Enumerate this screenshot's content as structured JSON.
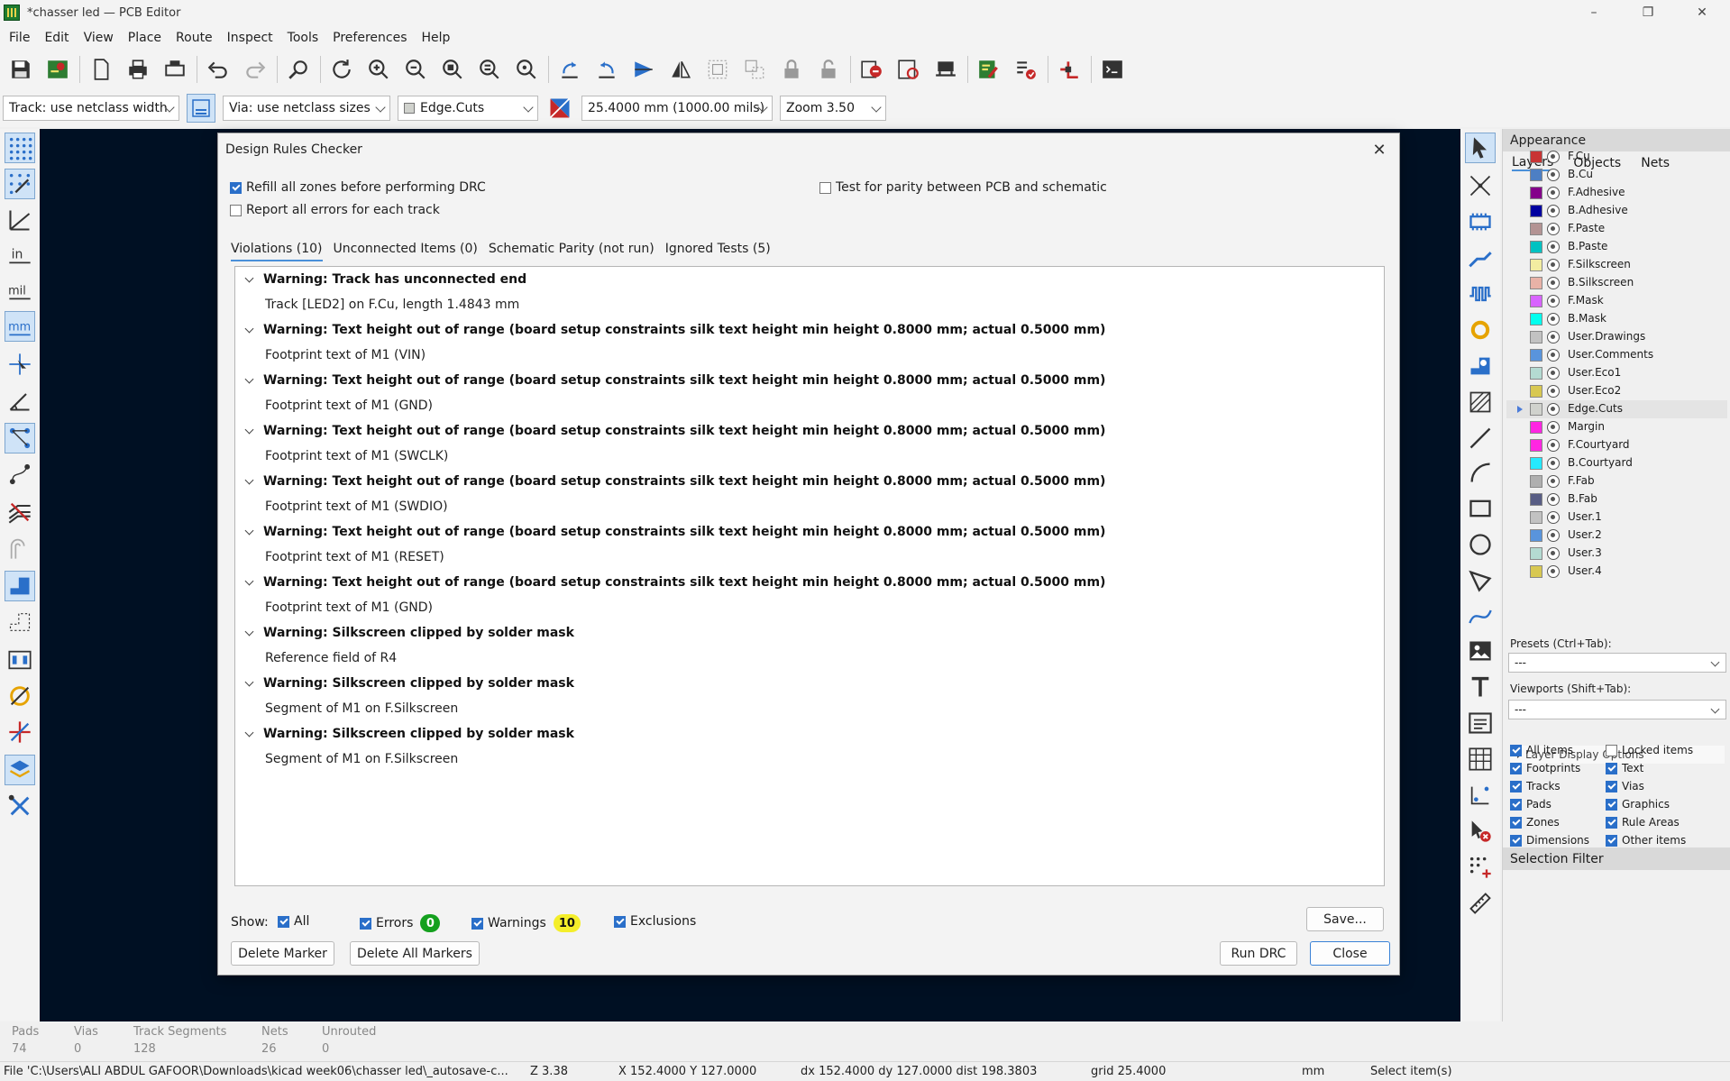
{
  "window": {
    "title": "*chasser led — PCB Editor",
    "minimize": "–",
    "restore": "❐",
    "close": "✕"
  },
  "menu": [
    "File",
    "Edit",
    "View",
    "Place",
    "Route",
    "Inspect",
    "Tools",
    "Preferences",
    "Help"
  ],
  "options_bar": {
    "track_width": "Track: use netclass width",
    "via_size": "Via: use netclass sizes",
    "layer": "Edge.Cuts",
    "grid": "25.4000 mm (1000.00 mils)",
    "zoom": "Zoom 3.50"
  },
  "dialog": {
    "title": "Design Rules Checker",
    "close": "✕",
    "opt_refill": "Refill all zones before performing DRC",
    "opt_report_all": "Report all errors for each track",
    "opt_parity": "Test for parity between PCB and schematic",
    "tabs": [
      "Violations (10)",
      "Unconnected Items (0)",
      "Schematic Parity (not run)",
      "Ignored Tests (5)"
    ],
    "violations": [
      {
        "title": "Warning: Track has unconnected end",
        "item": "Track [LED2] on F.Cu, length 1.4843 mm"
      },
      {
        "title": "Warning: Text height out of range (board setup constraints silk text height min height 0.8000 mm; actual 0.5000 mm)",
        "item": "Footprint text of M1 (VIN)"
      },
      {
        "title": "Warning: Text height out of range (board setup constraints silk text height min height 0.8000 mm; actual 0.5000 mm)",
        "item": "Footprint text of M1 (GND)"
      },
      {
        "title": "Warning: Text height out of range (board setup constraints silk text height min height 0.8000 mm; actual 0.5000 mm)",
        "item": "Footprint text of M1 (SWCLK)"
      },
      {
        "title": "Warning: Text height out of range (board setup constraints silk text height min height 0.8000 mm; actual 0.5000 mm)",
        "item": "Footprint text of M1 (SWDIO)"
      },
      {
        "title": "Warning: Text height out of range (board setup constraints silk text height min height 0.8000 mm; actual 0.5000 mm)",
        "item": "Footprint text of M1 (RESET)"
      },
      {
        "title": "Warning: Text height out of range (board setup constraints silk text height min height 0.8000 mm; actual 0.5000 mm)",
        "item": "Footprint text of M1 (GND)"
      },
      {
        "title": "Warning: Silkscreen clipped by solder mask",
        "item": "Reference field of R4"
      },
      {
        "title": "Warning: Silkscreen clipped by solder mask",
        "item": "Segment of M1 on F.Silkscreen"
      },
      {
        "title": "Warning: Silkscreen clipped by solder mask",
        "item": "Segment of M1 on F.Silkscreen"
      }
    ],
    "show_label": "Show:",
    "show_all": "All",
    "show_errors": "Errors",
    "errors_count": "0",
    "show_warnings": "Warnings",
    "warnings_count": "10",
    "show_exclusions": "Exclusions",
    "btn_save": "Save...",
    "btn_delete_marker": "Delete Marker",
    "btn_delete_all": "Delete All Markers",
    "btn_run": "Run DRC",
    "btn_close": "Close"
  },
  "appearance": {
    "header": "Appearance",
    "tabs": [
      "Layers",
      "Objects",
      "Nets"
    ],
    "layers": [
      {
        "name": "F.Cu",
        "color": "#c83434"
      },
      {
        "name": "B.Cu",
        "color": "#4d7fc4"
      },
      {
        "name": "F.Adhesive",
        "color": "#84008a"
      },
      {
        "name": "B.Adhesive",
        "color": "#0000a0"
      },
      {
        "name": "F.Paste",
        "color": "#b39393"
      },
      {
        "name": "B.Paste",
        "color": "#00c2c2"
      },
      {
        "name": "F.Silkscreen",
        "color": "#f2eda1"
      },
      {
        "name": "B.Silkscreen",
        "color": "#e8b2a7"
      },
      {
        "name": "F.Mask",
        "color": "#d864ff"
      },
      {
        "name": "B.Mask",
        "color": "#02ffee"
      },
      {
        "name": "User.Drawings",
        "color": "#c2c2c2"
      },
      {
        "name": "User.Comments",
        "color": "#5994dc"
      },
      {
        "name": "User.Eco1",
        "color": "#b4dbd2"
      },
      {
        "name": "User.Eco2",
        "color": "#d8c852"
      },
      {
        "name": "Edge.Cuts",
        "color": "#d0d2cd"
      },
      {
        "name": "Margin",
        "color": "#ff26e2"
      },
      {
        "name": "F.Courtyard",
        "color": "#ff26e2"
      },
      {
        "name": "B.Courtyard",
        "color": "#26e9ff"
      },
      {
        "name": "F.Fab",
        "color": "#afafaf"
      },
      {
        "name": "B.Fab",
        "color": "#585d84"
      },
      {
        "name": "User.1",
        "color": "#c2c2c2"
      },
      {
        "name": "User.2",
        "color": "#5994dc"
      },
      {
        "name": "User.3",
        "color": "#b4dbd2"
      },
      {
        "name": "User.4",
        "color": "#d8c852"
      }
    ],
    "layer_display_options": "Layer Display Options",
    "presets_label": "Presets (Ctrl+Tab):",
    "presets_value": "---",
    "viewports_label": "Viewports (Shift+Tab):",
    "viewports_value": "---"
  },
  "selection_filter": {
    "header": "Selection Filter",
    "items": [
      "All items",
      "Locked items",
      "Footprints",
      "Text",
      "Tracks",
      "Vias",
      "Pads",
      "Graphics",
      "Zones",
      "Rule Areas",
      "Dimensions",
      "Other items"
    ]
  },
  "message_panel": [
    {
      "label": "Pads",
      "value": "74"
    },
    {
      "label": "Vias",
      "value": "0"
    },
    {
      "label": "Track Segments",
      "value": "128"
    },
    {
      "label": "Nets",
      "value": "26"
    },
    {
      "label": "Unrouted",
      "value": "0"
    }
  ],
  "status": {
    "file": "File 'C:\\Users\\ALI ABDUL GAFOOR\\Downloads\\kicad week06\\chasser led\\_autosave-c...",
    "zoom": "Z 3.38",
    "coords": "X 152.4000  Y 127.0000",
    "delta": "dx 152.4000  dy 127.0000  dist 198.3803",
    "grid": "grid 25.4000",
    "units": "mm",
    "action": "Select item(s)"
  },
  "colors": {
    "canvas": "#001023",
    "accent": "#2a6fc9",
    "errors_badge": "#14a01e",
    "warnings_badge": "#f4ee2a"
  }
}
